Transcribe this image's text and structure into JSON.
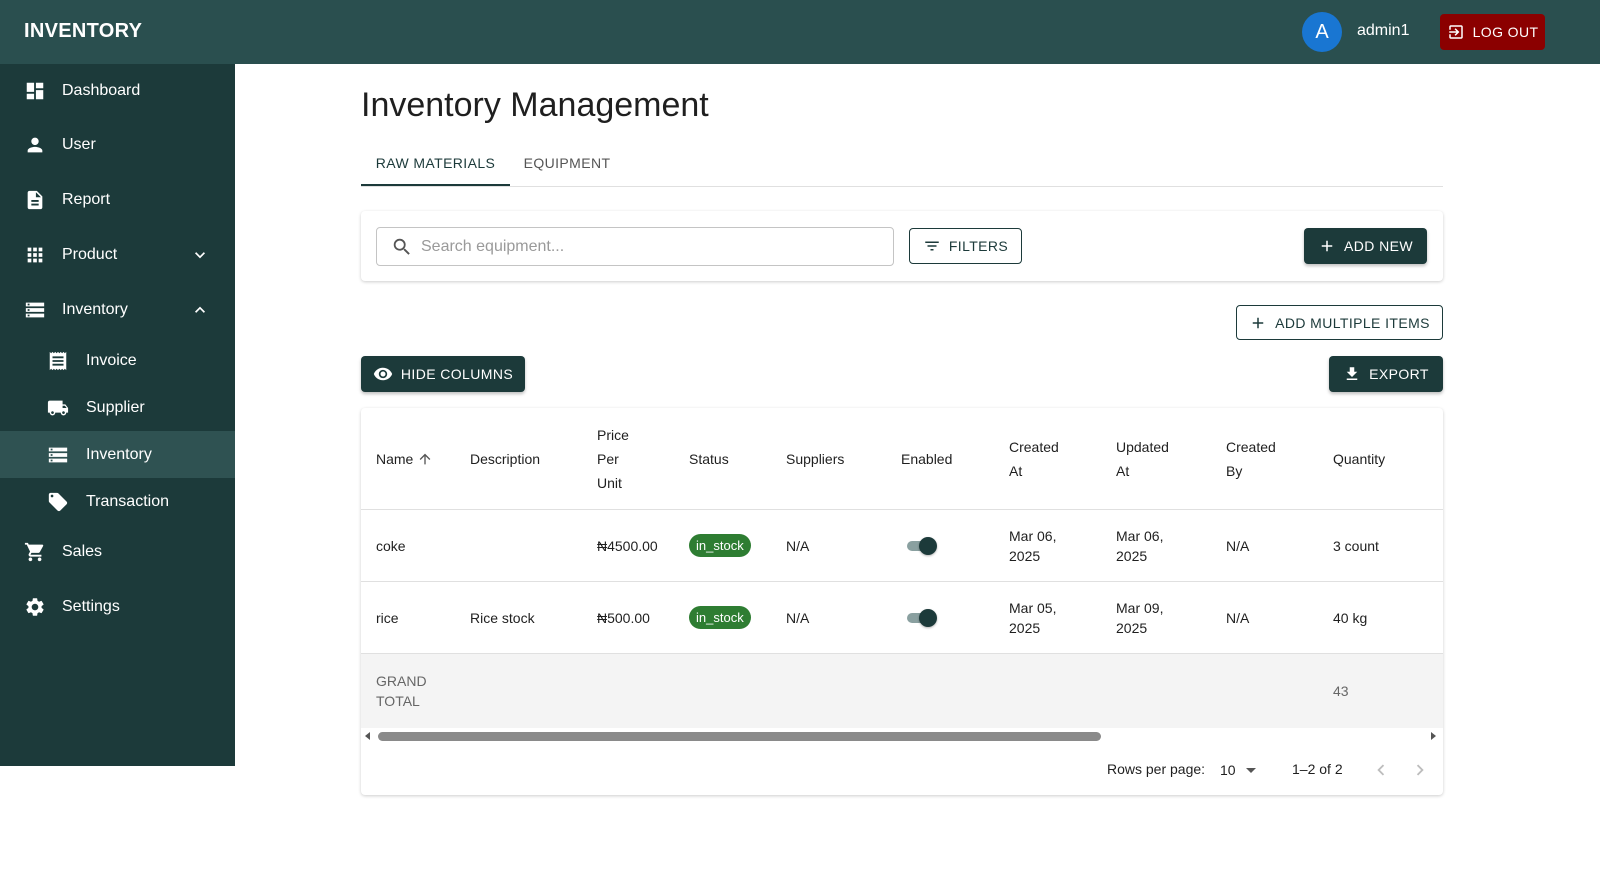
{
  "app": {
    "brand": "INVENTORY"
  },
  "header": {
    "avatar_initial": "A",
    "username": "admin1",
    "logout_label": "LOG OUT",
    "colors": {
      "bar": "#2a4f4f",
      "logout": "#8b0000",
      "avatar": "#1976d2"
    }
  },
  "sidebar": {
    "items": [
      {
        "label": "Dashboard",
        "icon": "dashboard-icon"
      },
      {
        "label": "User",
        "icon": "person-icon"
      },
      {
        "label": "Report",
        "icon": "document-icon"
      },
      {
        "label": "Product",
        "icon": "apps-grid-icon",
        "expandable": true,
        "expanded": false
      },
      {
        "label": "Inventory",
        "icon": "storage-icon",
        "expandable": true,
        "expanded": true
      },
      {
        "label": "Sales",
        "icon": "cart-icon"
      },
      {
        "label": "Settings",
        "icon": "gear-icon"
      }
    ],
    "sub_items": [
      {
        "label": "Invoice",
        "icon": "receipt-icon"
      },
      {
        "label": "Supplier",
        "icon": "truck-icon"
      },
      {
        "label": "Inventory",
        "icon": "storage-icon",
        "active": true
      },
      {
        "label": "Transaction",
        "icon": "tag-icon"
      }
    ]
  },
  "main": {
    "title": "Inventory Management",
    "tabs": [
      {
        "label": "RAW MATERIALS",
        "active": true
      },
      {
        "label": "EQUIPMENT",
        "active": false
      }
    ],
    "search": {
      "placeholder": "Search equipment...",
      "value": ""
    },
    "filters_label": "FILTERS",
    "add_new_label": "ADD NEW",
    "add_multiple_label": "ADD MULTIPLE ITEMS",
    "hide_columns_label": "HIDE COLUMNS",
    "export_label": "EXPORT"
  },
  "table": {
    "columns": [
      {
        "label": "Name",
        "sorted": "asc"
      },
      {
        "label": "Description"
      },
      {
        "label": "Price Per Unit"
      },
      {
        "label": "Status"
      },
      {
        "label": "Suppliers"
      },
      {
        "label": "Enabled"
      },
      {
        "label": "Created At"
      },
      {
        "label": "Updated At"
      },
      {
        "label": "Created By"
      },
      {
        "label": "Quantity"
      }
    ],
    "column_lines": {
      "price": [
        "Price",
        "Per",
        "Unit"
      ],
      "created_at": [
        "Created",
        "At"
      ],
      "updated_at": [
        "Updated",
        "At"
      ],
      "created_by": [
        "Created",
        "By"
      ]
    },
    "rows": [
      {
        "name": "coke",
        "description": "",
        "price": "₦4500.00",
        "status": "in_stock",
        "suppliers": "N/A",
        "enabled": true,
        "created_at": [
          "Mar 06,",
          "2025"
        ],
        "updated_at": [
          "Mar 06,",
          "2025"
        ],
        "created_by": "N/A",
        "quantity": "3 count"
      },
      {
        "name": "rice",
        "description": "Rice stock",
        "price": "₦500.00",
        "status": "in_stock",
        "suppliers": "N/A",
        "enabled": true,
        "created_at": [
          "Mar 05,",
          "2025"
        ],
        "updated_at": [
          "Mar 09,",
          "2025"
        ],
        "created_by": "N/A",
        "quantity": "40 kg"
      }
    ],
    "total": {
      "label_lines": [
        "GRAND",
        "TOTAL"
      ],
      "quantity": "43"
    },
    "status_color": "#2e7d32"
  },
  "pagination": {
    "rows_per_page_label": "Rows per page:",
    "rows_per_page": "10",
    "range": "1–2 of 2"
  }
}
